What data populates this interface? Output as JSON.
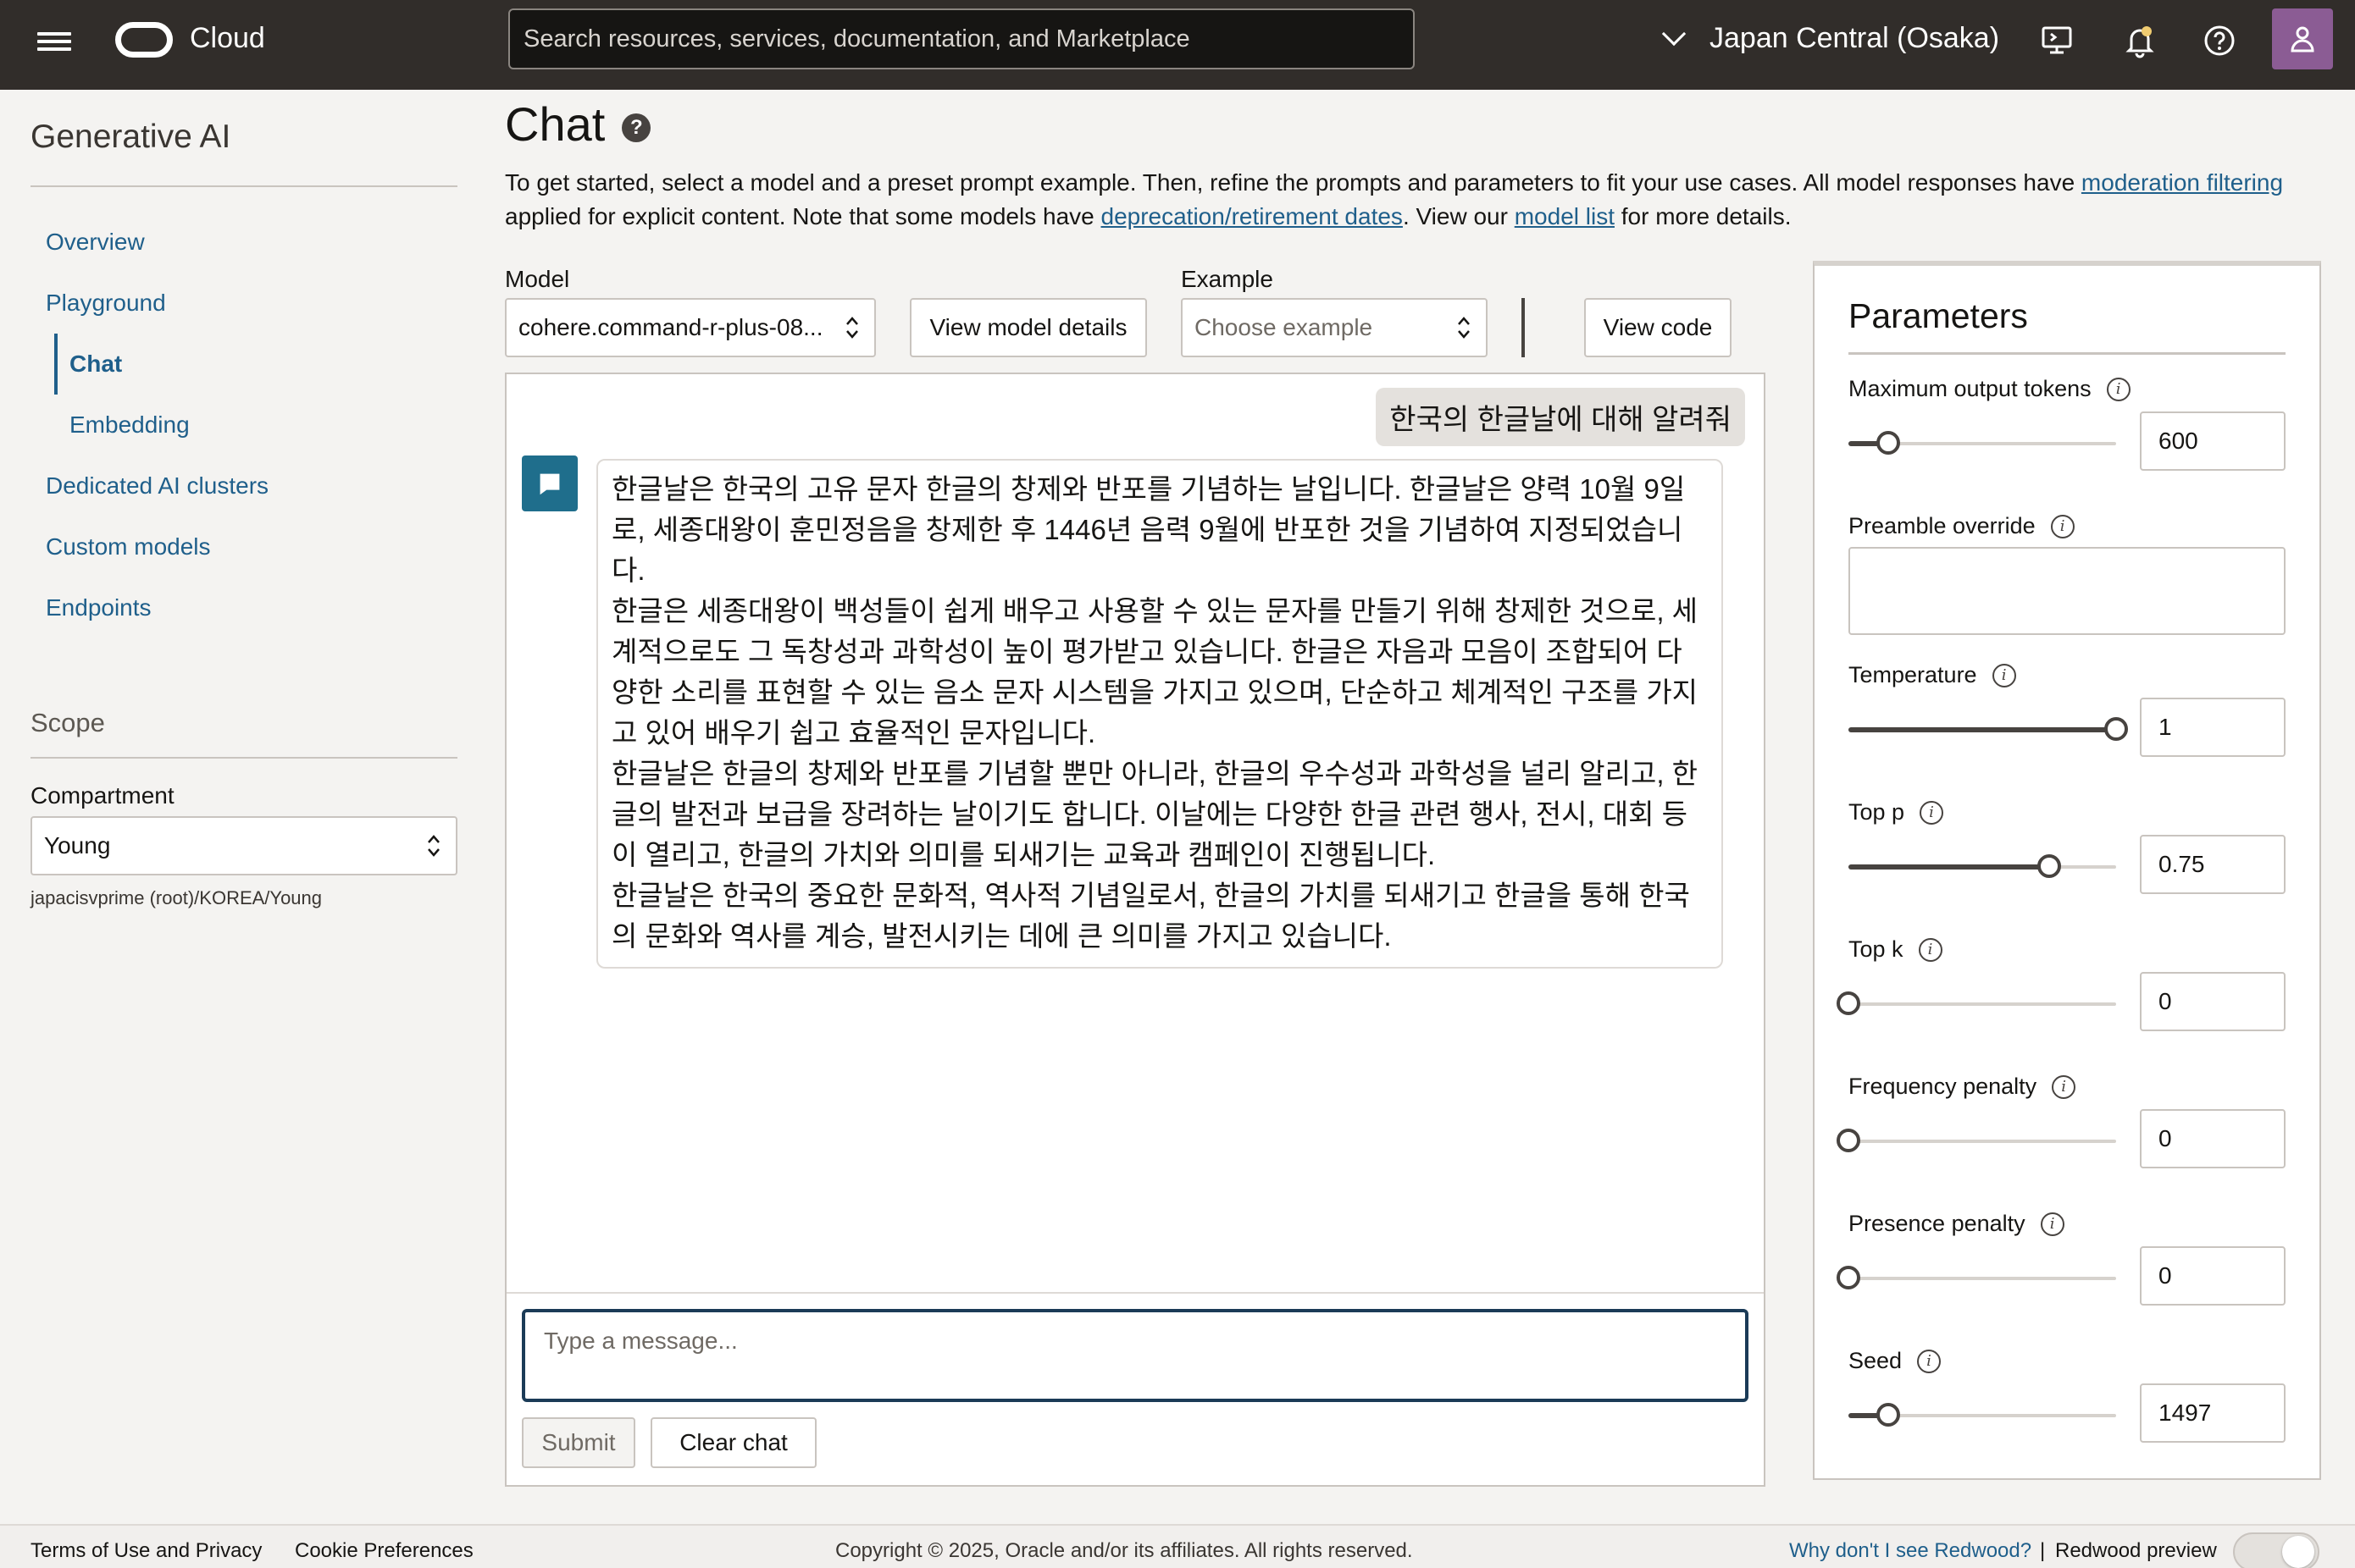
{
  "header": {
    "brand": "Cloud",
    "search_placeholder": "Search resources, services, documentation, and Marketplace",
    "region": "Japan Central (Osaka)"
  },
  "sidebar": {
    "title": "Generative AI",
    "items": [
      {
        "label": "Overview"
      },
      {
        "label": "Playground"
      },
      {
        "label": "Chat"
      },
      {
        "label": "Embedding"
      },
      {
        "label": "Dedicated AI clusters"
      },
      {
        "label": "Custom models"
      },
      {
        "label": "Endpoints"
      }
    ],
    "scope_title": "Scope",
    "compartment_label": "Compartment",
    "compartment_value": "Young",
    "compartment_path": "japacisvprime (root)/KOREA/Young"
  },
  "main": {
    "title": "Chat",
    "intro_1": "To get started, select a model and a preset prompt example. Then, refine the prompts and parameters to fit your use cases. All model responses have ",
    "intro_link_1": "moderation filtering",
    "intro_2": " applied for explicit content. Note that some models have ",
    "intro_link_2": "deprecation/retirement dates",
    "intro_3": ". View our ",
    "intro_link_3": "model list",
    "intro_4": " for more details.",
    "model_label": "Model",
    "model_value": "cohere.command-r-plus-08...",
    "view_model_details": "View model details",
    "example_label": "Example",
    "example_placeholder": "Choose example",
    "view_code": "View code"
  },
  "chat": {
    "user_message": "한국의 한글날에 대해 알려줘",
    "bot_paragraphs": [
      "한글날은 한국의 고유 문자 한글의 창제와 반포를 기념하는 날입니다. 한글날은 양력 10월 9일로, 세종대왕이 훈민정음을 창제한 후 1446년 음력 9월에 반포한 것을 기념하여 지정되었습니다.",
      "한글은 세종대왕이 백성들이 쉽게 배우고 사용할 수 있는 문자를 만들기 위해 창제한 것으로, 세계적으로도 그 독창성과 과학성이 높이 평가받고 있습니다. 한글은 자음과 모음이 조합되어 다양한 소리를 표현할 수 있는 음소 문자 시스템을 가지고 있으며, 단순하고 체계적인 구조를 가지고 있어 배우기 쉽고 효율적인 문자입니다.",
      "한글날은 한글의 창제와 반포를 기념할 뿐만 아니라, 한글의 우수성과 과학성을 널리 알리고, 한글의 발전과 보급을 장려하는 날이기도 합니다. 이날에는 다양한 한글 관련 행사, 전시, 대회 등이 열리고, 한글의 가치와 의미를 되새기는 교육과 캠페인이 진행됩니다.",
      "한글날은 한국의 중요한 문화적, 역사적 기념일로서, 한글의 가치를 되새기고 한글을 통해 한국의 문화와 역사를 계승, 발전시키는 데에 큰 의미를 가지고 있습니다."
    ],
    "input_placeholder": "Type a message...",
    "submit": "Submit",
    "clear": "Clear chat"
  },
  "params": {
    "title": "Parameters",
    "max_tokens": {
      "label": "Maximum output tokens",
      "value": "600",
      "level": 0.15
    },
    "preamble": {
      "label": "Preamble override"
    },
    "temperature": {
      "label": "Temperature",
      "value": "1",
      "level": 1.0
    },
    "top_p": {
      "label": "Top p",
      "value": "0.75",
      "level": 0.75
    },
    "top_k": {
      "label": "Top k",
      "value": "0",
      "level": 0.0
    },
    "frequency": {
      "label": "Frequency penalty",
      "value": "0",
      "level": 0.0
    },
    "presence": {
      "label": "Presence penalty",
      "value": "0",
      "level": 0.0
    },
    "seed": {
      "label": "Seed",
      "value": "1497",
      "level": 0.15
    }
  },
  "footer": {
    "terms": "Terms of Use and Privacy",
    "cookies": "Cookie Preferences",
    "copyright": "Copyright © 2025, Oracle and/or its affiliates. All rights reserved.",
    "redwood_link": "Why don't I see Redwood?",
    "sep": "|",
    "redwood_preview": "Redwood preview"
  }
}
